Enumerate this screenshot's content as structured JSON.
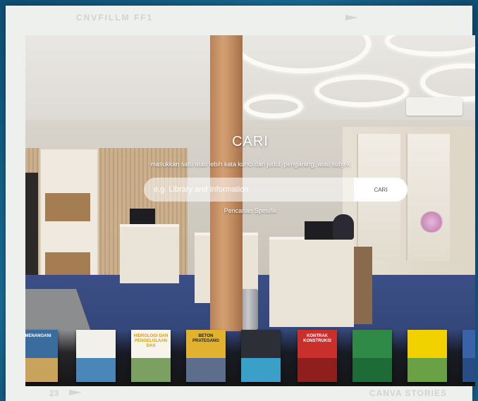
{
  "frame": {
    "brand": "CNVFILLM FF1",
    "page_number": "23",
    "footer_label": "CANVA STORIES"
  },
  "search": {
    "title": "CARI",
    "subtitle": "masukkan satu atau lebih kata kunci dari judul, pengarang, atau subjek",
    "placeholder": "e.g. Library and Information",
    "button_label": "CARI",
    "advanced_label": "Pencarian Spesifik"
  },
  "books": [
    {
      "title": "MENANGANI",
      "cover": "#3b6c9e",
      "text": "#ffffff",
      "art": "#c9a25b"
    },
    {
      "title": "",
      "cover": "#f2f0ea",
      "text": "#1f4a87",
      "art": "#4b86b8"
    },
    {
      "title": "HIDROLOGI DAN PENGELOLAAN DAS",
      "cover": "#f7f4ec",
      "text": "#d7a200",
      "art": "#7c9f62"
    },
    {
      "title": "BETON PRATEGANG",
      "cover": "#e0b230",
      "text": "#222222",
      "art": "#5c6e8c"
    },
    {
      "title": "",
      "cover": "#2c2f36",
      "text": "#8fc7e2",
      "art": "#3aa0c8"
    },
    {
      "title": "KONTRAK KONSTRUKSI",
      "cover": "#c9302c",
      "text": "#ffffff",
      "art": "#8e1f1c"
    },
    {
      "title": "",
      "cover": "#2f8a48",
      "text": "#ffffff",
      "art": "#1d6b37"
    },
    {
      "title": "",
      "cover": "#f1d100",
      "text": "#1f5a9c",
      "art": "#6aa046"
    },
    {
      "title": "",
      "cover": "#3a62a8",
      "text": "#ffffff",
      "art": "#2a4c86"
    }
  ],
  "colors": {
    "background": "#175e86",
    "frame": "#eef0ee",
    "search_button": "#ffffff"
  }
}
